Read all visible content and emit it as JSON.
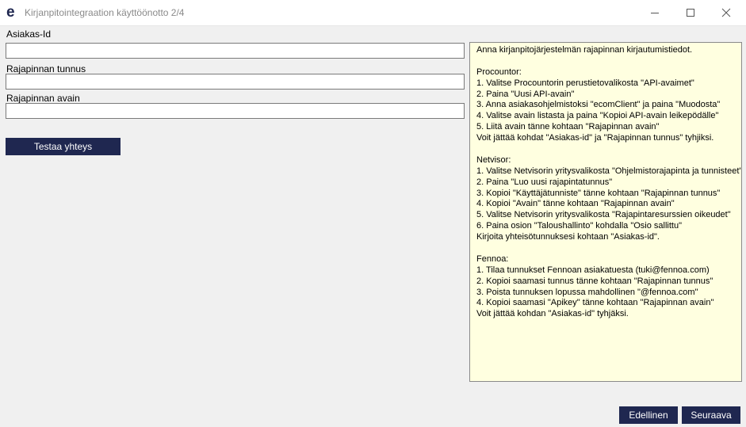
{
  "window": {
    "title": "Kirjanpitointegraation käyttöönotto 2/4",
    "logo_letter": "e"
  },
  "form": {
    "customer_id": {
      "label": "Asiakas-Id",
      "value": ""
    },
    "api_id": {
      "label": "Rajapinnan tunnus",
      "value": ""
    },
    "api_key": {
      "label": "Rajapinnan avain",
      "value": ""
    },
    "test_button": "Testaa yhteys"
  },
  "help": {
    "lines": [
      "Anna kirjanpitojärjestelmän rajapinnan kirjautumistiedot.",
      "",
      "Procountor:",
      "1. Valitse Procountorin perustietovalikosta \"API-avaimet\"",
      "2. Paina \"Uusi API-avain\"",
      "3. Anna asiakasohjelmistoksi \"ecomClient\" ja paina \"Muodosta\"",
      "4. Valitse avain listasta ja paina \"Kopioi API-avain leikepödälle\"",
      "5. Liitä avain tänne kohtaan \"Rajapinnan avain\"",
      "Voit jättää kohdat \"Asiakas-id\" ja \"Rajapinnan tunnus\" tyhjiksi.",
      "",
      "Netvisor:",
      "1. Valitse Netvisorin yritysvalikosta \"Ohjelmistorajapinta ja tunnisteet\"",
      "2. Paina \"Luo uusi rajapintatunnus\"",
      "3. Kopioi \"Käyttäjätunniste\" tänne kohtaan \"Rajapinnan tunnus\"",
      "4. Kopioi \"Avain\" tänne kohtaan \"Rajapinnan avain\"",
      "5. Valitse Netvisorin yritysvalikosta \"Rajapintaresurssien oikeudet\"",
      "6. Paina osion \"Taloushallinto\" kohdalla \"Osio sallittu\"",
      "Kirjoita yhteisötunnuksesi kohtaan \"Asiakas-id\".",
      "",
      "Fennoa:",
      "1. Tilaa tunnukset Fennoan asiakatuesta (tuki@fennoa.com)",
      "2. Kopioi saamasi tunnus tänne kohtaan \"Rajapinnan tunnus\"",
      "3. Poista tunnuksen lopussa mahdollinen \"@fennoa.com\"",
      "4. Kopioi saamasi \"Apikey\" tänne kohtaan \"Rajapinnan avain\"",
      "Voit jättää kohdan \"Asiakas-id\" tyhjäksi."
    ]
  },
  "footer": {
    "prev_button": "Edellinen",
    "next_button": "Seuraava"
  },
  "colors": {
    "button_bg": "#1f2750",
    "help_bg": "#ffffe0",
    "logo": "#1f2750"
  }
}
